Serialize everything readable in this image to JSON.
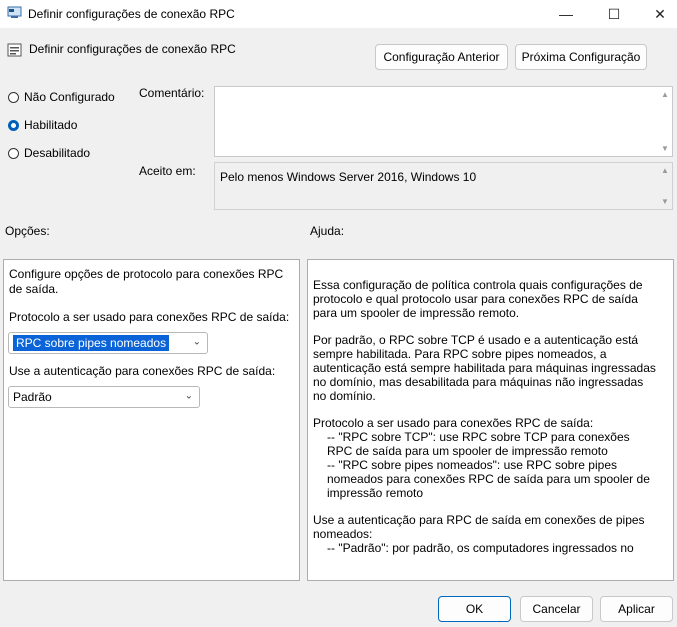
{
  "window": {
    "title": "Definir configurações de conexão RPC",
    "minimize": "—",
    "maximize": "☐",
    "close": "✕"
  },
  "header": {
    "policy_title": "Definir configurações de conexão RPC",
    "prev_button": "Configuração Anterior",
    "next_button": "Próxima Configuração"
  },
  "state": {
    "options": [
      {
        "label": "Não Configurado",
        "selected": false
      },
      {
        "label": "Habilitado",
        "selected": true
      },
      {
        "label": "Desabilitado",
        "selected": false
      }
    ]
  },
  "comment": {
    "label": "Comentário:",
    "value": ""
  },
  "supported": {
    "label": "Aceito em:",
    "value": "Pelo menos Windows Server 2016, Windows 10"
  },
  "options_panel": {
    "label": "Opções:",
    "description": "Configure opções de protocolo para conexões RPC de saída.",
    "protocol_label": "Protocolo a ser usado para conexões RPC de saída:",
    "protocol_value": "RPC sobre pipes nomeados",
    "auth_label": "Use a autenticação para conexões RPC de saída:",
    "auth_value": "Padrão"
  },
  "help_panel": {
    "label": "Ajuda:",
    "p1": "Essa configuração de política controla quais configurações de protocolo e qual protocolo usar para conexões RPC de saída para um spooler de impressão remoto.",
    "p2": "Por padrão, o RPC sobre TCP é usado e a autenticação está sempre habilitada. Para RPC sobre pipes nomeados, a autenticação está sempre habilitada para máquinas ingressadas no domínio, mas desabilitada para máquinas não ingressadas no domínio.",
    "p3a": "Protocolo a ser usado para conexões RPC de saída:",
    "p3b": "-- \"RPC sobre TCP\": use RPC sobre TCP para conexões RPC de saída para um spooler de impressão remoto",
    "p3c": "-- \"RPC sobre pipes nomeados\": use RPC sobre pipes nomeados para conexões RPC de saída para um spooler de impressão remoto",
    "p4a": "Use a autenticação para RPC de saída em conexões de pipes nomeados:",
    "p4b": "-- \"Padrão\": por padrão, os computadores ingressados no"
  },
  "footer": {
    "ok": "OK",
    "cancel": "Cancelar",
    "apply": "Aplicar"
  }
}
